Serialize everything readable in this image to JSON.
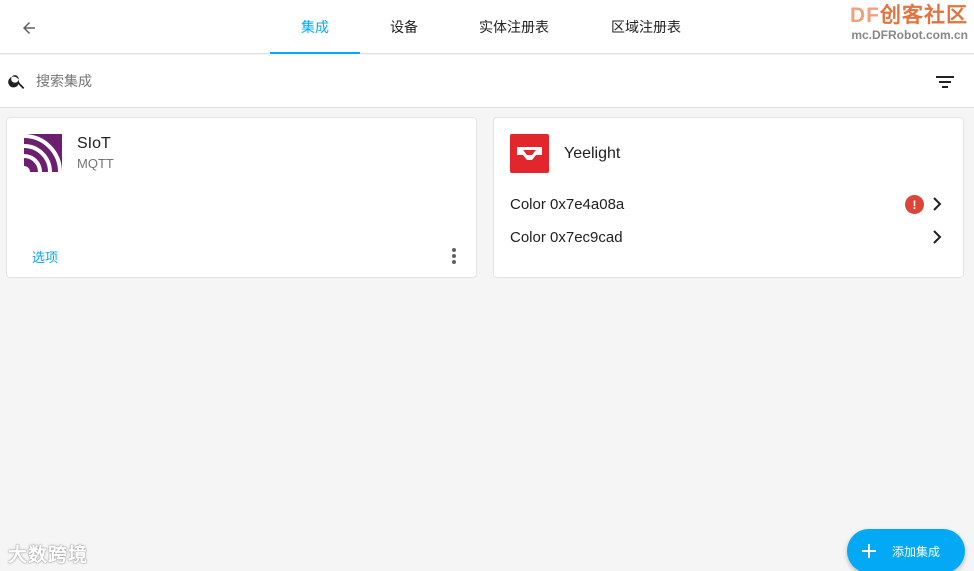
{
  "header": {
    "back_icon": "arrow-left-icon",
    "tabs": [
      {
        "label": "集成",
        "active": true
      },
      {
        "label": "设备",
        "active": false
      },
      {
        "label": "实体注册表",
        "active": false
      },
      {
        "label": "区域注册表",
        "active": false
      }
    ],
    "accent_color": "#03a9f4"
  },
  "watermark_top": {
    "logo_prefix": "DF",
    "logo_rest": "创客社区",
    "url": "mc.DFRobot.com.cn"
  },
  "search": {
    "placeholder": "搜索集成",
    "value": "",
    "filter_icon": "filter-icon"
  },
  "integrations": [
    {
      "name": "SIoT",
      "subtitle": "MQTT",
      "options_label": "选项",
      "logo_icon": "siot-logo-icon",
      "logo_color": "#6b1f6e"
    },
    {
      "name": "Yeelight",
      "logo_icon": "yeelight-logo-icon",
      "logo_color": "#e3262b",
      "devices": [
        {
          "name": "Color 0x7e4a08a",
          "error": true,
          "badge": "!"
        },
        {
          "name": "Color 0x7ec9cad",
          "error": false
        }
      ]
    }
  ],
  "fab": {
    "label": "添加集成",
    "icon": "plus-icon"
  },
  "watermark_bottom": {
    "text": "大数跨境"
  }
}
